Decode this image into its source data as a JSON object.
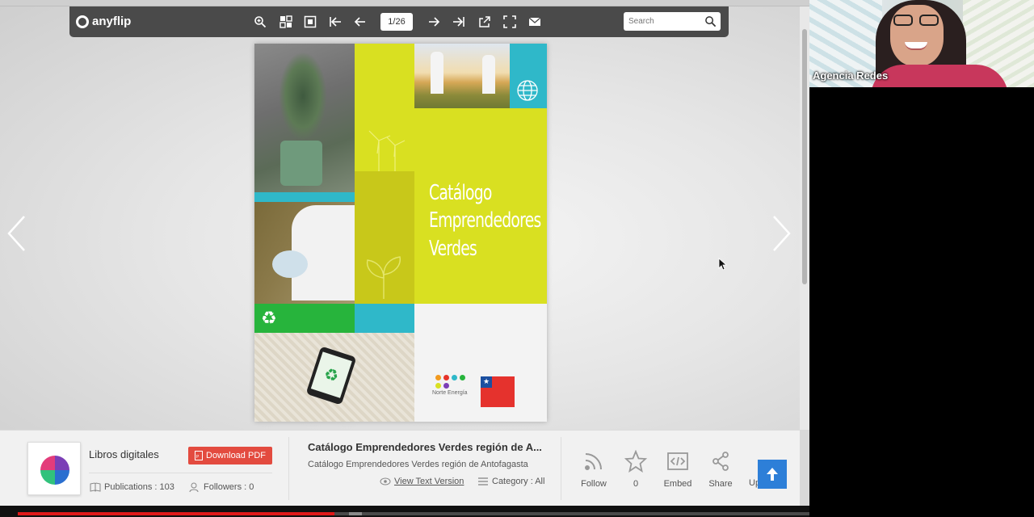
{
  "toolbar": {
    "brand": "anyflip",
    "page_indicator": "1/26",
    "search_placeholder": "Search",
    "icons": [
      "zoom-in-icon",
      "thumbnails-icon",
      "single-page-icon",
      "first-page-icon",
      "previous-page-icon",
      "next-page-icon",
      "last-page-icon",
      "share-icon",
      "fullscreen-icon",
      "email-icon",
      "search-icon"
    ]
  },
  "book": {
    "title_lines": [
      "Catálogo",
      "Emprendedores",
      "Verdes"
    ],
    "logo_caption": "Norte Energía"
  },
  "publisher": {
    "name": "Libros digitales",
    "download_label": "Download PDF",
    "publications": "Publications : 103",
    "followers": "Followers : 0"
  },
  "document": {
    "title": "Catálogo Emprendedores Verdes región de A...",
    "subtitle": "Catálogo Emprendedores Verdes región de Antofagasta",
    "text_version_label": "View Text Version",
    "category": "Category : All"
  },
  "actions": {
    "follow": "Follow",
    "like_count": "0",
    "embed": "Embed",
    "share": "Share",
    "upload_partial": "Up"
  },
  "webcam": {
    "participant_name": "Agencia Redes"
  },
  "video": {
    "played_fraction": 0.4
  },
  "colors": {
    "toolbar_bg": "#4a4a4a",
    "download_button": "#e34b3f",
    "upload_button": "#2d7fd8",
    "progress_played": "#e01919",
    "book_lime": "#d9e021",
    "book_teal": "#2fb8c9",
    "book_green": "#27b43c"
  }
}
